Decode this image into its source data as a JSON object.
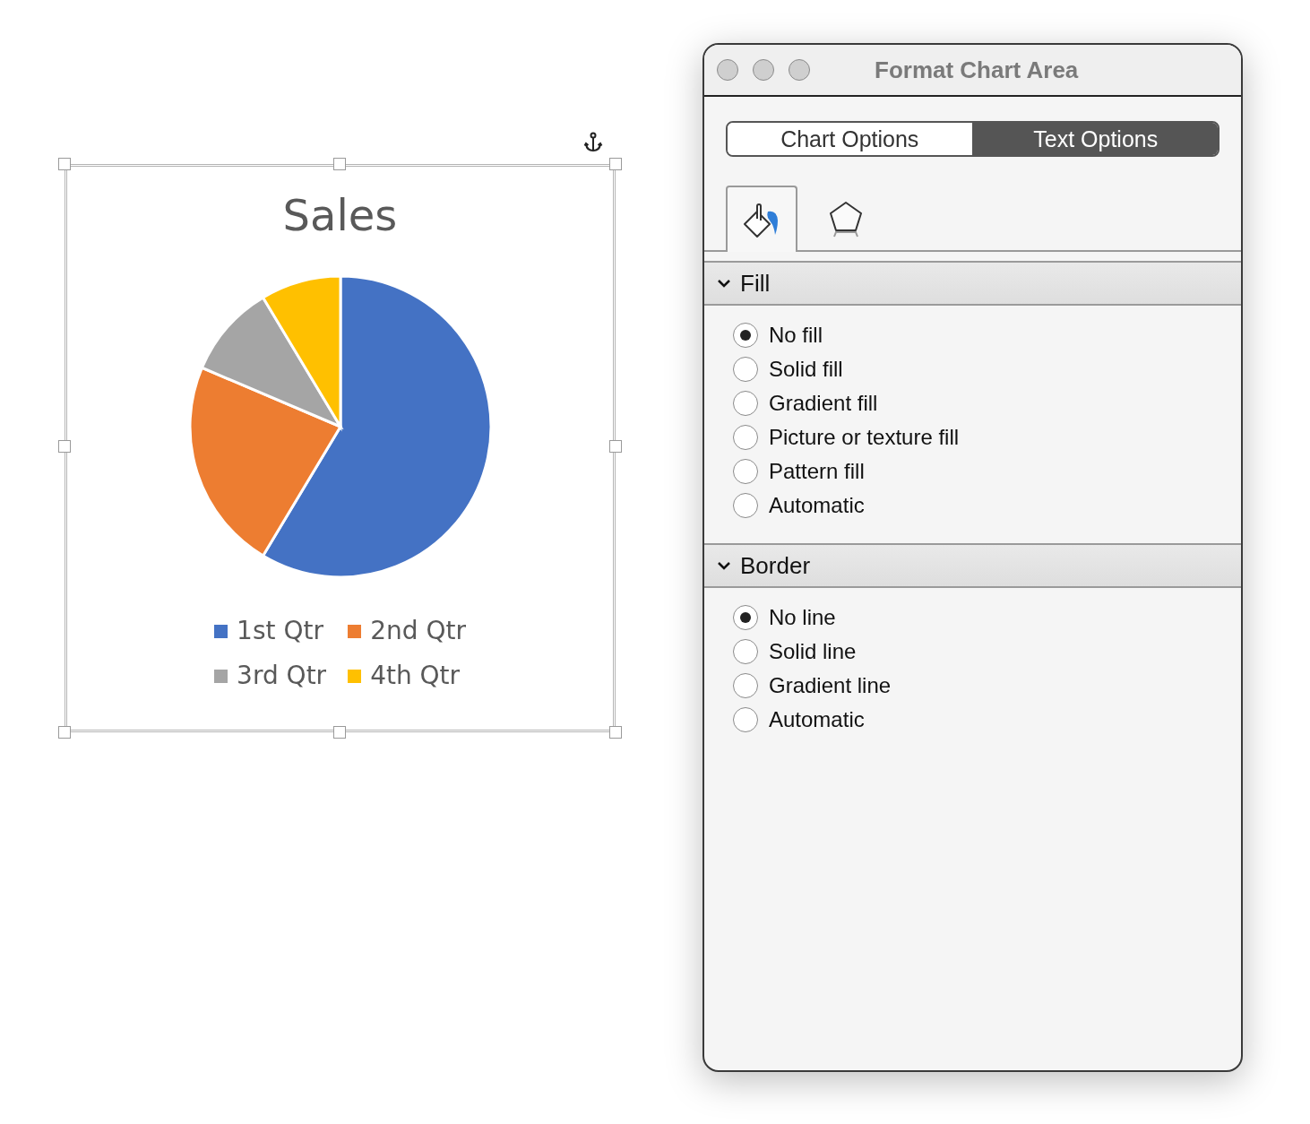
{
  "chart": {
    "title": "Sales",
    "legend": [
      {
        "label": "1st Qtr",
        "color": "#4472c4"
      },
      {
        "label": "2nd Qtr",
        "color": "#ed7d31"
      },
      {
        "label": "3rd Qtr",
        "color": "#a5a5a5"
      },
      {
        "label": "4th Qtr",
        "color": "#ffc000"
      }
    ]
  },
  "panel": {
    "title": "Format Chart Area",
    "tabs": [
      {
        "label": "Chart Options",
        "selected": false
      },
      {
        "label": "Text Options",
        "selected": true
      }
    ],
    "icon_tabs": [
      {
        "kind": "fill",
        "selected": true
      },
      {
        "kind": "shape",
        "selected": false
      }
    ],
    "sections": [
      {
        "title": "Fill",
        "expanded": true,
        "options": [
          {
            "label": "No fill",
            "selected": true
          },
          {
            "label": "Solid fill",
            "selected": false
          },
          {
            "label": "Gradient fill",
            "selected": false
          },
          {
            "label": "Picture or texture fill",
            "selected": false
          },
          {
            "label": "Pattern fill",
            "selected": false
          },
          {
            "label": "Automatic",
            "selected": false
          }
        ]
      },
      {
        "title": "Border",
        "expanded": true,
        "options": [
          {
            "label": "No line",
            "selected": true
          },
          {
            "label": "Solid line",
            "selected": false
          },
          {
            "label": "Gradient line",
            "selected": false
          },
          {
            "label": "Automatic",
            "selected": false
          }
        ]
      }
    ]
  }
}
